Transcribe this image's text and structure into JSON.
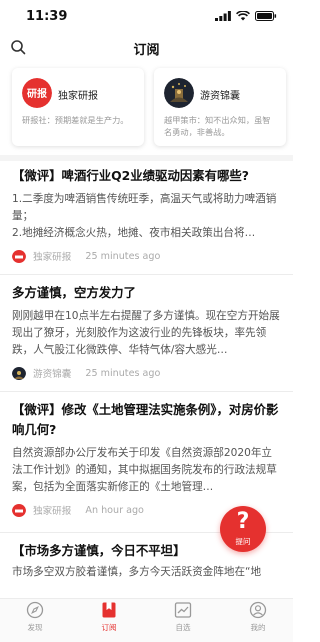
{
  "status_bar": {
    "time": "11:39"
  },
  "nav": {
    "title": "订阅"
  },
  "cards": [
    {
      "logo_text": "研报",
      "name": "独家研报",
      "desc": "研报社：预期差就是生产力。"
    },
    {
      "name": "游资锦囊",
      "desc": "越甲策市：知不出众知，虽智名勇动，非善战。"
    }
  ],
  "articles": [
    {
      "title": "【微评】啤酒行业Q2业绩驱动因素有哪些?",
      "summary": "1.二季度为啤酒销售传统旺季，高温天气或将助力啤酒销量；\n2.地摊经济概念火热，地摊、夜市相关政策出台将…",
      "source": "独家研报",
      "time": "25 minutes ago"
    },
    {
      "title": "多方谨慎，空方发力了",
      "summary": "刚刚越甲在10点半左右提醒了多方谨慎。现在空方开始展现出了獠牙，光刻胶作为这波行业的先锋板块，率先领跌，人气股江化微跌停、华特气体/容大感光…",
      "source": "游资锦囊",
      "time": "25 minutes ago"
    },
    {
      "title": "【微评】修改《土地管理法实施条例》，对房价影响几何?",
      "summary": "自然资源部办公厅发布关于印发《自然资源部2020年立法工作计划》的通知，其中拟据国务院发布的行政法规草案，包括为全面落实新修正的《土地管理…",
      "source": "独家研报",
      "time": "An hour ago"
    },
    {
      "title": "【市场多方谨慎，今日不平坦】",
      "summary": "市场多空双方胶着谨慎，多方今天活跃资金阵地在“地"
    }
  ],
  "ask_button": {
    "icon": "?",
    "label": "提问"
  },
  "tabbar": [
    {
      "label": "发现",
      "icon": "compass-icon"
    },
    {
      "label": "订阅",
      "icon": "bookmark-icon",
      "active": true
    },
    {
      "label": "自选",
      "icon": "chart-icon"
    },
    {
      "label": "我的",
      "icon": "user-icon"
    }
  ],
  "colors": {
    "accent": "#e5312f",
    "text": "#111111",
    "muted": "#aaaaaa"
  }
}
